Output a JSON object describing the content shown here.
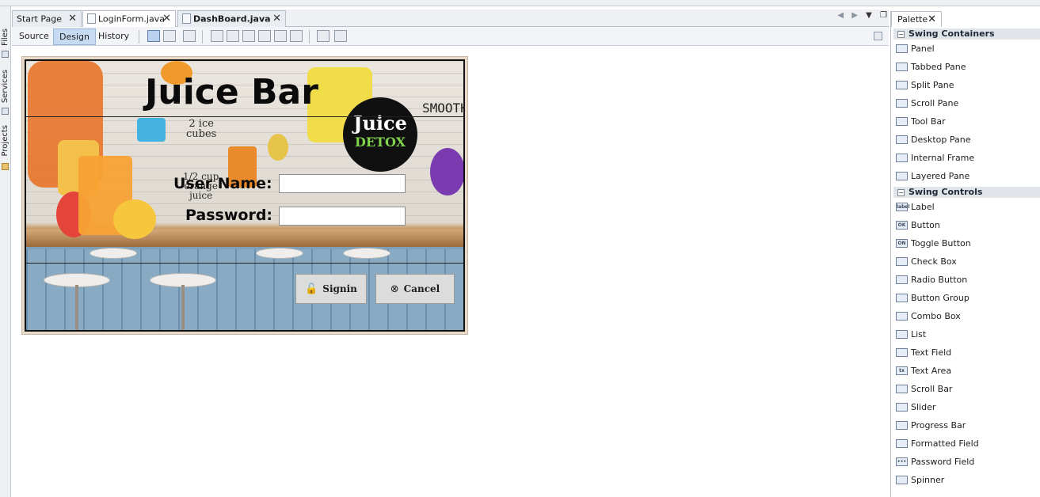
{
  "left_sidebar": {
    "items": [
      {
        "label": "Files"
      },
      {
        "label": "Services"
      },
      {
        "label": "Projects"
      }
    ]
  },
  "editor_tabs": [
    {
      "label": "Start Page",
      "close": "✕"
    },
    {
      "label": "LoginForm.java",
      "close": "✕"
    },
    {
      "label": "DashBoard.java",
      "close": "✕"
    }
  ],
  "design_toolbar": {
    "source": "Source",
    "design": "Design",
    "history": "History"
  },
  "palette": {
    "title": "Palette",
    "close": "✕",
    "categories": [
      {
        "label": "Swing Containers",
        "toggle": "−"
      },
      {
        "label": "Swing Controls",
        "toggle": "−"
      }
    ],
    "containers": [
      {
        "label": "Panel",
        "icon": ""
      },
      {
        "label": "Tabbed Pane",
        "icon": ""
      },
      {
        "label": "Split Pane",
        "icon": ""
      },
      {
        "label": "Scroll Pane",
        "icon": ""
      },
      {
        "label": "Tool Bar",
        "icon": ""
      },
      {
        "label": "Desktop Pane",
        "icon": ""
      },
      {
        "label": "Internal Frame",
        "icon": ""
      },
      {
        "label": "Layered Pane",
        "icon": ""
      }
    ],
    "controls": [
      {
        "label": "Label",
        "icon": "label"
      },
      {
        "label": "Button",
        "icon": "OK"
      },
      {
        "label": "Toggle Button",
        "icon": "ON"
      },
      {
        "label": "Check Box",
        "icon": ""
      },
      {
        "label": "Radio Button",
        "icon": ""
      },
      {
        "label": "Button Group",
        "icon": ""
      },
      {
        "label": "Combo Box",
        "icon": ""
      },
      {
        "label": "List",
        "icon": ""
      },
      {
        "label": "Text Field",
        "icon": ""
      },
      {
        "label": "Text Area",
        "icon": "tx"
      },
      {
        "label": "Scroll Bar",
        "icon": ""
      },
      {
        "label": "Slider",
        "icon": ""
      },
      {
        "label": "Progress Bar",
        "icon": ""
      },
      {
        "label": "Formatted Field",
        "icon": ""
      },
      {
        "label": "Password Field",
        "icon": "•••"
      },
      {
        "label": "Spinner",
        "icon": ""
      }
    ]
  },
  "form": {
    "title": "Juice Bar",
    "username_label": "User Name:",
    "password_label": "Password:",
    "username_value": "",
    "password_value": "",
    "signin_label": "Signin",
    "cancel_label": "Cancel",
    "artwork": {
      "badge_line1": "Juice",
      "badge_line2": "DETOX",
      "ice_note": "2 ice\ncubes",
      "orange_note": "1/2 cup\norange\njuice",
      "smoothie": "SMOOTH"
    }
  },
  "colors": {
    "accent_selected": "#c6dbf2",
    "palette_category_bg": "#e1e4e8",
    "form_button_bg": "#dcdcdc"
  }
}
